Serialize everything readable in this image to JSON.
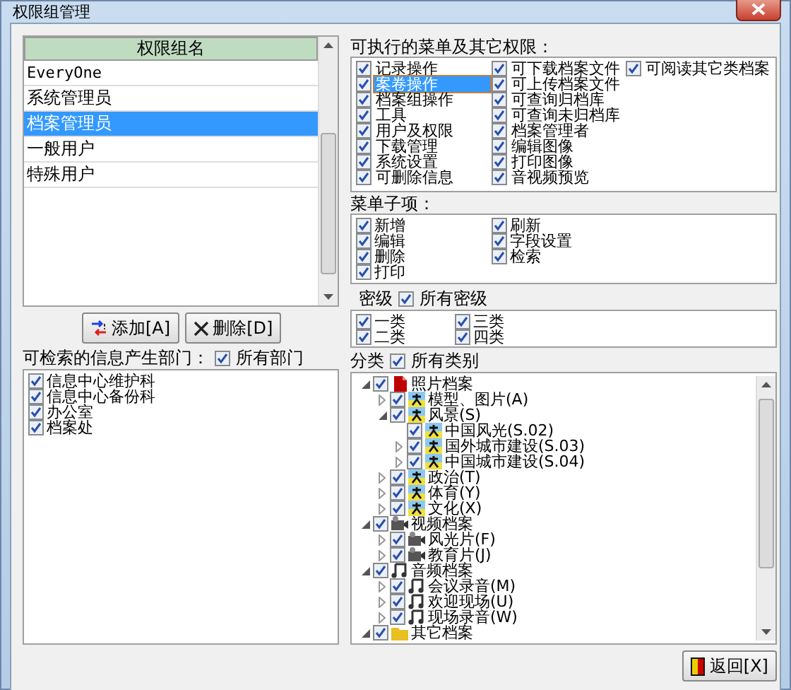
{
  "window": {
    "title": "权限组管理"
  },
  "groups": {
    "header": "权限组名",
    "rows": [
      {
        "name": "EveryOne",
        "selected": false
      },
      {
        "name": "系统管理员",
        "selected": false
      },
      {
        "name": "档案管理员",
        "selected": true
      },
      {
        "name": "一般用户",
        "selected": false
      },
      {
        "name": "特殊用户",
        "selected": false
      }
    ]
  },
  "buttons": [
    {
      "label": "添加[A]",
      "kind": "add"
    },
    {
      "label": "删除[D]",
      "kind": "delete"
    }
  ],
  "departments": {
    "label": "可检索的信息产生部门：",
    "all": {
      "label": "所有部门",
      "checked": true
    },
    "items": [
      {
        "label": "信息中心维护科",
        "checked": true
      },
      {
        "label": "信息中心备份科",
        "checked": true
      },
      {
        "label": "办公室",
        "checked": true
      },
      {
        "label": "档案处",
        "checked": true
      }
    ]
  },
  "menus": {
    "label": "可执行的菜单及其它权限：",
    "columns": [
      [
        {
          "label": "记录操作",
          "checked": true,
          "selected": false
        },
        {
          "label": "案卷操作",
          "checked": true,
          "selected": true
        },
        {
          "label": "档案组操作",
          "checked": true,
          "selected": false
        },
        {
          "label": "工具",
          "checked": true,
          "selected": false
        },
        {
          "label": "用户及权限",
          "checked": true,
          "selected": false
        },
        {
          "label": "下载管理",
          "checked": true,
          "selected": false
        },
        {
          "label": "系统设置",
          "checked": true,
          "selected": false
        },
        {
          "label": "可删除信息",
          "checked": true,
          "selected": false
        }
      ],
      [
        {
          "label": "可下载档案文件",
          "checked": true,
          "selected": false
        },
        {
          "label": "可上传档案文件",
          "checked": true,
          "selected": false
        },
        {
          "label": "可查询归档库",
          "checked": true,
          "selected": false
        },
        {
          "label": "可查询未归档库",
          "checked": true,
          "selected": false
        },
        {
          "label": "档案管理者",
          "checked": true,
          "selected": false
        },
        {
          "label": "编辑图像",
          "checked": true,
          "selected": false
        },
        {
          "label": "打印图像",
          "checked": true,
          "selected": false
        },
        {
          "label": "音视频预览",
          "checked": true,
          "selected": false
        }
      ],
      [
        {
          "label": "可阅读其它类档案",
          "checked": true,
          "selected": false
        }
      ]
    ]
  },
  "subitems": {
    "label": "菜单子项：",
    "columns": [
      [
        {
          "label": "新增",
          "checked": true
        },
        {
          "label": "编辑",
          "checked": true
        },
        {
          "label": "删除",
          "checked": true
        },
        {
          "label": "打印",
          "checked": true
        }
      ],
      [
        {
          "label": "刷新",
          "checked": true
        },
        {
          "label": "字段设置",
          "checked": true
        },
        {
          "label": "检索",
          "checked": true
        }
      ]
    ]
  },
  "secrecy": {
    "label": "密级",
    "all": {
      "label": "所有密级",
      "checked": true
    },
    "columns": [
      [
        {
          "label": "一类",
          "checked": true
        },
        {
          "label": "二类",
          "checked": true
        }
      ],
      [
        {
          "label": "三类",
          "checked": true
        },
        {
          "label": "四类",
          "checked": true
        }
      ]
    ]
  },
  "categories": {
    "label": "分类",
    "all": {
      "label": "所有类别",
      "checked": true
    },
    "tree": [
      {
        "label": "照片档案",
        "kind": "document",
        "checked": true,
        "expanded": true,
        "children": [
          {
            "label": "模型、图片(A)",
            "kind": "figure",
            "checked": true,
            "expanded": false
          },
          {
            "label": "风景(S)",
            "kind": "figure",
            "checked": true,
            "expanded": true,
            "children": [
              {
                "label": "中国风光(S.02)",
                "kind": "figure",
                "checked": true
              },
              {
                "label": "国外城市建设(S.03)",
                "kind": "figure",
                "checked": true,
                "expanded": false
              },
              {
                "label": "中国城市建设(S.04)",
                "kind": "figure",
                "checked": true,
                "expanded": false
              }
            ]
          },
          {
            "label": "政治(T)",
            "kind": "figure",
            "checked": true,
            "expanded": false
          },
          {
            "label": "体育(Y)",
            "kind": "figure",
            "checked": true,
            "expanded": false
          },
          {
            "label": "文化(X)",
            "kind": "figure",
            "checked": true,
            "expanded": false
          }
        ]
      },
      {
        "label": "视频档案",
        "kind": "camera",
        "checked": true,
        "expanded": true,
        "children": [
          {
            "label": "风光片(F)",
            "kind": "camera",
            "checked": true,
            "expanded": false
          },
          {
            "label": "教育片(J)",
            "kind": "camera",
            "checked": true,
            "expanded": false
          }
        ]
      },
      {
        "label": "音频档案",
        "kind": "music",
        "checked": true,
        "expanded": true,
        "children": [
          {
            "label": "会议录音(M)",
            "kind": "music",
            "checked": true,
            "expanded": false
          },
          {
            "label": "欢迎现场(U)",
            "kind": "music",
            "checked": true,
            "expanded": false
          },
          {
            "label": "现场录音(W)",
            "kind": "music",
            "checked": true,
            "expanded": false
          }
        ]
      },
      {
        "label": "其它档案",
        "kind": "folder",
        "checked": true,
        "expanded": true
      }
    ]
  },
  "return_button": {
    "label": "返回[X]"
  }
}
